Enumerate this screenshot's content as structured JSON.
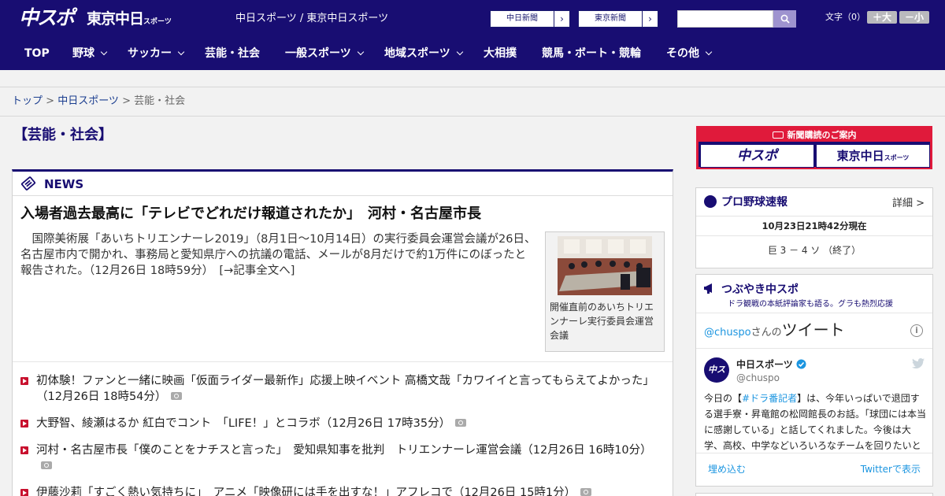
{
  "header": {
    "logo_chuspo": "中スポ",
    "logo_tokyo": "東京中日",
    "logo_tokyo_small": "スポーツ",
    "site_title": "中日スポーツ / 東京中日スポーツ",
    "ext_links": [
      {
        "label": "中日新聞",
        "arrow": "›"
      },
      {
        "label": "東京新聞",
        "arrow": "›"
      }
    ],
    "search_placeholder": "",
    "font_size_label": "文字（0）",
    "font_plus": "＋大",
    "font_minus": "－小"
  },
  "nav": {
    "items": [
      {
        "label": "TOP",
        "has_menu": false
      },
      {
        "label": "野球",
        "has_menu": true
      },
      {
        "label": "サッカー",
        "has_menu": true
      },
      {
        "label": "芸能・社会",
        "has_menu": false
      },
      {
        "label": "一般スポーツ",
        "has_menu": true
      },
      {
        "label": "地域スポーツ",
        "has_menu": true
      },
      {
        "label": "大相撲",
        "has_menu": false
      },
      {
        "label": "競馬・ボート・競輪",
        "has_menu": false
      },
      {
        "label": "その他",
        "has_menu": true
      }
    ]
  },
  "breadcrumb": {
    "top": "トップ",
    "sep1": " > ",
    "chunichi": "中日スポーツ",
    "sep2": " > ",
    "current": "芸能・社会"
  },
  "section_title": "【芸能・社会】",
  "news": {
    "heading": "NEWS",
    "lead": {
      "title": "入場者過去最高に「テレビでどれだけ報道されたか」　河村・名古屋市長",
      "text": "国際美術展「あいちトリエンナーレ2019」（8月1日～10月14日）の実行委員会運営会議が26日、名古屋市内で開かれ、事務局と愛知県庁への抗議の電話、メールが8月だけで約1万件にのぼったと報告された。（12月26日 18時59分）　[→記事全文へ]",
      "photo_caption": "開催直前のあいちトリエンナーレ実行委員会運営会議"
    },
    "items": [
      {
        "text": "初体験！ファンと一緒に映画「仮面ライダー最新作」応援上映イベント 高橋文哉「カワイイと言ってもらえてよかった」（12月26日 18時54分）"
      },
      {
        "text": "大野智、綾瀬はるか 紅白でコント　「LIFE！」とコラボ（12月26日 17時35分）"
      },
      {
        "text": "河村・名古屋市長「僕のことをナチスと言った」　愛知県知事を批判　トリエンナーレ運営会議（12月26日 16時10分）"
      },
      {
        "text": "伊藤沙莉「すごく熱い気持ちに」　アニメ「映像研には手を出すな！」アフレコで（12月26日 15時1分）"
      }
    ]
  },
  "promo": {
    "heading": "新聞購読のご案内",
    "btn_chuspo": "中スポ",
    "btn_tokyo": "東京中日",
    "btn_tokyo_small": "スポーツ"
  },
  "baseball": {
    "heading": "プロ野球速報",
    "more": "詳細 >",
    "date": "10月23日21時42分現在",
    "score": "巨 3 － 4 ソ （終了）"
  },
  "tweet": {
    "heading": "つぶやき中スポ",
    "sub": "ドラ観戦の本紙評論家も語る。グラも熱烈応援",
    "widget_handle": "@chuspo",
    "widget_san": "さんの",
    "widget_title": "ツイート",
    "info": "i",
    "avatar": "中スポ",
    "name": "中日スポーツ",
    "handle": "@chuspo",
    "text_pre": "今日の【",
    "text_tag": "#ドラ番記者",
    "text_post": "】は、今年いっぱいで退団する選手寮・昇竜館の松岡館長のお話。「球団には本当に感謝している」と話してくれました。今後は大学、高校、中学などいろいろなチームを回りたいと",
    "embed": "埋め込む",
    "view": "Twitterで表示"
  },
  "colors": {
    "brand_navy": "#180d72",
    "accent_red": "#e01a3b",
    "link_blue": "#1b95e0"
  }
}
